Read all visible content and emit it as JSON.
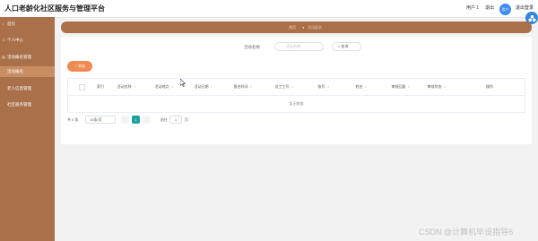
{
  "app": {
    "title": "人口老龄化社区服务与管理平台"
  },
  "topbar": {
    "user": "用户 1",
    "exit_label": "退出",
    "avatar_text": "用户",
    "logout_label": "退出登录"
  },
  "sidebar": {
    "items": [
      {
        "label": "首页",
        "icon": "home-icon"
      },
      {
        "label": "个人中心",
        "icon": "user-icon"
      },
      {
        "label": "活动报名管理",
        "icon": "calendar-icon"
      },
      {
        "label": "活动报名",
        "icon": "list-icon"
      },
      {
        "label": "老人信息管理",
        "icon": "people-icon"
      },
      {
        "label": "社区服务管理",
        "icon": "service-icon"
      }
    ]
  },
  "breadcrumb": {
    "home": "首页",
    "separator": "●",
    "current": "活动报名"
  },
  "search": {
    "label": "活动名称",
    "placeholder": "活动名称",
    "button": "查询"
  },
  "toolbar": {
    "add_label": "+ 添加"
  },
  "table": {
    "columns": [
      "索引",
      "活动名称",
      "活动地点",
      "活动日期",
      "报名时间",
      "员工工号",
      "账号",
      "姓名",
      "审核回复",
      "审核状态",
      "操作"
    ],
    "empty_text": "暂无数据"
  },
  "pagination": {
    "total": "共 0 条",
    "page_size": "10条/页",
    "prev": "‹",
    "current": "1",
    "next": "›",
    "goto_label": "前往",
    "goto_value": "1",
    "page_unit": "页"
  },
  "watermark": "CSDN @计算机毕设指导6",
  "colors": {
    "sidebar": "#a9704a",
    "accent": "#ef8a52",
    "active_page": "#1aa39a"
  }
}
